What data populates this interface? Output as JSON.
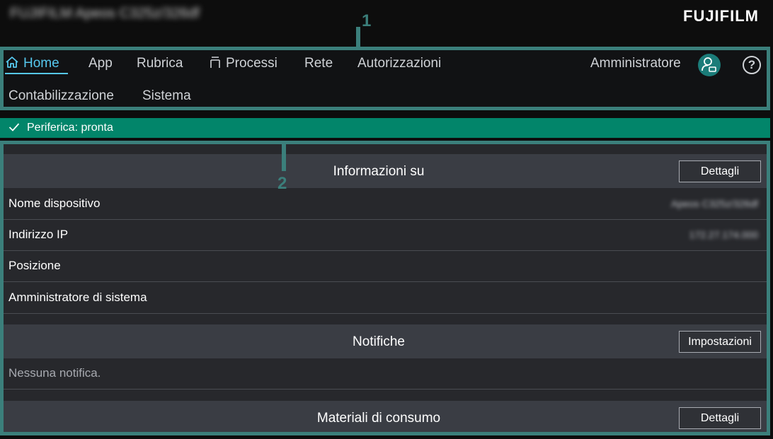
{
  "header": {
    "device_title": "FUJIFILM Apeos C325z/326df",
    "brand": "FUJIFILM"
  },
  "callouts": [
    "1",
    "2"
  ],
  "nav": {
    "items": [
      {
        "label": "Home",
        "icon": "home-icon",
        "active": true
      },
      {
        "label": "App"
      },
      {
        "label": "Rubrica"
      },
      {
        "label": "Processi",
        "icon": "jobs-icon"
      },
      {
        "label": "Rete"
      },
      {
        "label": "Autorizzazioni"
      },
      {
        "label": "Contabilizzazione"
      },
      {
        "label": "Sistema"
      }
    ],
    "user_label": "Amministratore",
    "user_icon": "user-icon",
    "help_icon": "help-icon"
  },
  "status": {
    "text": "Periferica: pronta",
    "icon": "check-icon",
    "color": "#02856a"
  },
  "info_section": {
    "title": "Informazioni su",
    "button": "Dettagli",
    "rows": [
      {
        "label": "Nome dispositivo",
        "value": "Apeos C325z/326df"
      },
      {
        "label": "Indirizzo IP",
        "value": "172.27.174.000"
      },
      {
        "label": "Posizione",
        "value": ""
      },
      {
        "label": "Amministratore di sistema",
        "value": ""
      }
    ]
  },
  "notifications_section": {
    "title": "Notifiche",
    "button": "Impostazioni",
    "empty_text": "Nessuna notifica."
  },
  "consumables_section": {
    "title": "Materiali di consumo",
    "button": "Dettagli"
  },
  "colors": {
    "accent": "#56c8ee",
    "callout": "#3b7f7b",
    "status_ok": "#02856a"
  }
}
